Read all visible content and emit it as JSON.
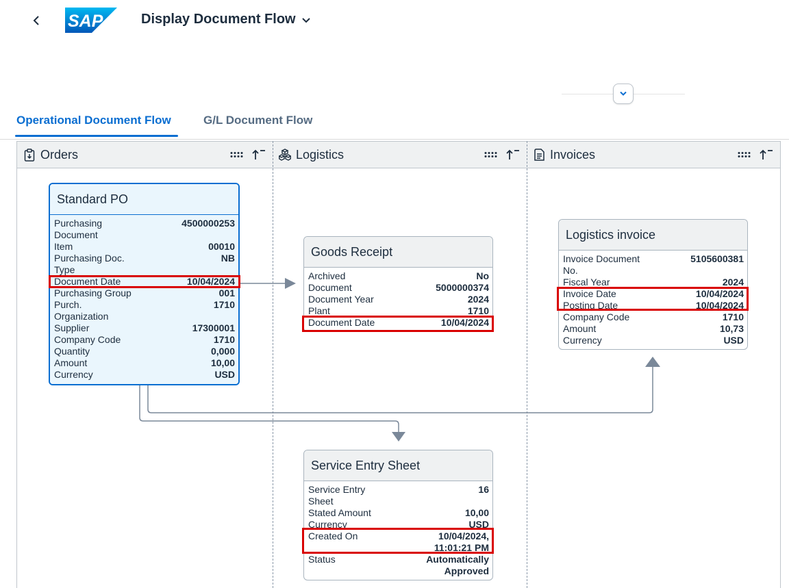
{
  "header": {
    "title": "Display Document Flow"
  },
  "tabs": [
    {
      "label": "Operational Document Flow",
      "selected": true
    },
    {
      "label": "G/L Document Flow",
      "selected": false
    }
  ],
  "lanes": [
    {
      "title": "Orders",
      "icon": "clipboard-icon"
    },
    {
      "title": "Logistics",
      "icon": "cubes-icon"
    },
    {
      "title": "Invoices",
      "icon": "document-icon"
    }
  ],
  "cards": {
    "standard_po": {
      "title": "Standard PO",
      "rows": [
        {
          "label": "Purchasing Document",
          "value": "4500000253"
        },
        {
          "label": "Item",
          "value": "00010"
        },
        {
          "label": "Purchasing Doc. Type",
          "value": "NB"
        },
        {
          "label": "Document Date",
          "value": "10/04/2024"
        },
        {
          "label": "Purchasing Group",
          "value": "001"
        },
        {
          "label": "Purch. Organization",
          "value": "1710"
        },
        {
          "label": "Supplier",
          "value": "17300001"
        },
        {
          "label": "Company Code",
          "value": "1710"
        },
        {
          "label": "Quantity",
          "value": "0,000"
        },
        {
          "label": "Amount",
          "value": "10,00"
        },
        {
          "label": "Currency",
          "value": "USD"
        }
      ]
    },
    "goods_receipt": {
      "title": "Goods Receipt",
      "rows": [
        {
          "label": "Archived",
          "value": "No"
        },
        {
          "label": "Document",
          "value": "5000000374"
        },
        {
          "label": "Document Year",
          "value": "2024"
        },
        {
          "label": "Plant",
          "value": "1710"
        },
        {
          "label": "Document Date",
          "value": "10/04/2024"
        }
      ]
    },
    "logistics_invoice": {
      "title": "Logistics invoice",
      "rows": [
        {
          "label": "Invoice Document No.",
          "value": "5105600381"
        },
        {
          "label": "Fiscal Year",
          "value": "2024"
        },
        {
          "label": "Invoice Date",
          "value": "10/04/2024"
        },
        {
          "label": "Posting Date",
          "value": "10/04/2024"
        },
        {
          "label": "Company Code",
          "value": "1710"
        },
        {
          "label": "Amount",
          "value": "10,73"
        },
        {
          "label": "Currency",
          "value": "USD"
        }
      ]
    },
    "service_entry_sheet": {
      "title": "Service Entry Sheet",
      "rows": [
        {
          "label": "Service Entry Sheet",
          "value": "16"
        },
        {
          "label": "Stated Amount",
          "value": "10,00"
        },
        {
          "label": "Currency",
          "value": "USD"
        },
        {
          "label": "Created On",
          "value": "10/04/2024, 11:01:21 PM"
        },
        {
          "label": "Status",
          "value": "Automatically Approved"
        }
      ]
    }
  }
}
